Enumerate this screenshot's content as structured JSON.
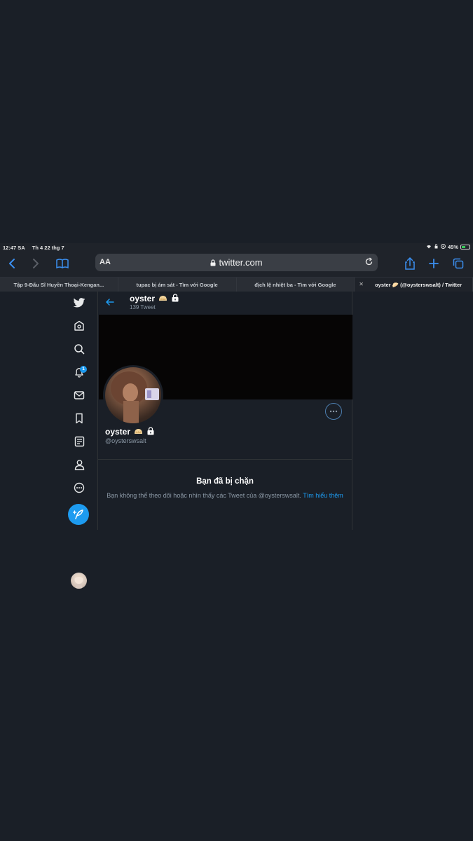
{
  "status_bar": {
    "time": "12:47 SA",
    "date": "Th 4 22 thg 7",
    "battery": "45%",
    "battery_level": 0.45
  },
  "browser": {
    "text_size_label": "AA",
    "url": "twitter.com",
    "tabs": [
      {
        "label": "Tập 9-Đấu Sĩ Huyền Thoại-Kengan...",
        "active": false
      },
      {
        "label": "tupac bị ám sát - Tìm với Google",
        "active": false
      },
      {
        "label": "địch lệ nhiệt ba - Tìm với Google",
        "active": false
      },
      {
        "label": "oyster 🥟 (@oysterswsalt) / Twitter",
        "active": true
      }
    ]
  },
  "nav": {
    "notification_count": "1",
    "accent": "#1d9bf0"
  },
  "profile": {
    "name": "oyster",
    "tweet_count": "139 Tweet",
    "handle": "@oysterswsalt",
    "blocked_title": "Bạn đã bị chặn",
    "blocked_message": "Bạn không thể theo dõi hoặc nhìn thấy các Tweet của @oysterswsalt.",
    "learn_more": "Tìm hiểu thêm"
  }
}
